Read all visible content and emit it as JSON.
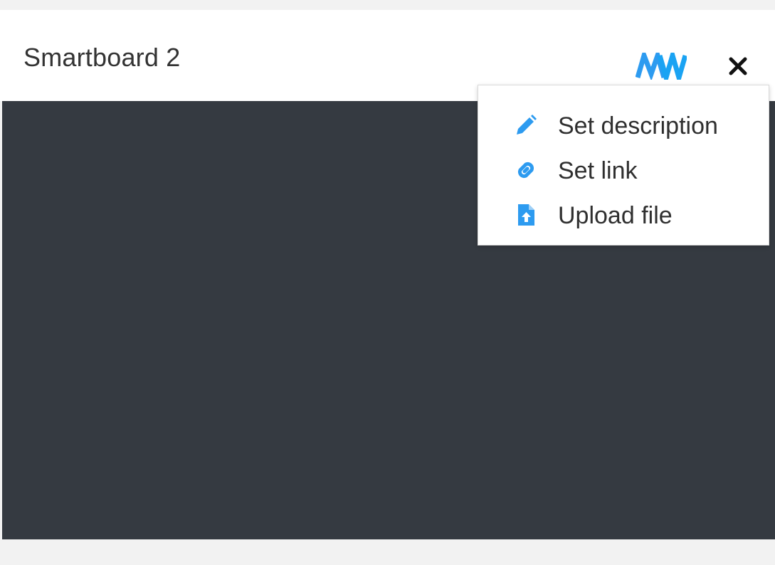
{
  "window": {
    "title": "Smartboard 2"
  },
  "header_icons": {
    "logo": "mw-logo-icon",
    "close": "close-icon"
  },
  "colors": {
    "accent": "#2d9bf0",
    "canvas": "#353a41",
    "header_bg": "#ffffff",
    "page_bg": "#f2f2f2"
  },
  "menu": {
    "items": [
      {
        "label": "Set description",
        "icon": "pencil-icon"
      },
      {
        "label": "Set link",
        "icon": "link-icon"
      },
      {
        "label": "Upload file",
        "icon": "file-upload-icon"
      }
    ]
  }
}
